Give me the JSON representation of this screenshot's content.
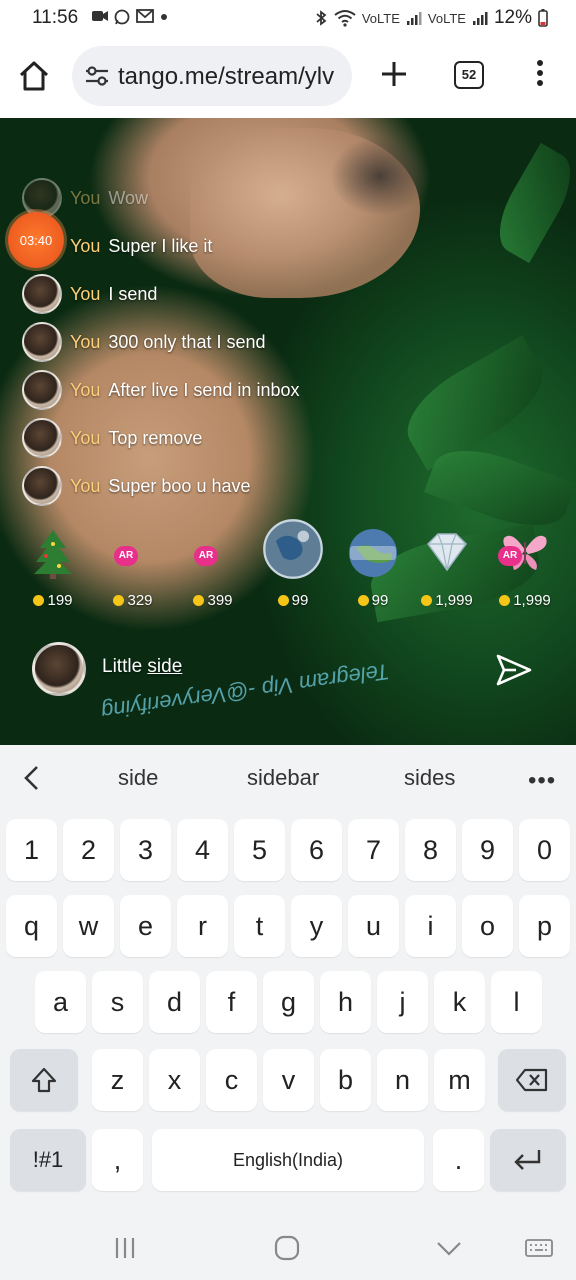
{
  "status_bar": {
    "time": "11:56",
    "notification_icons": [
      "video-icon",
      "whatsapp-icon",
      "gmail-icon",
      "dot-icon"
    ],
    "signal_text_1": "VoLTE",
    "signal_text_2": "VoLTE",
    "battery": "12%"
  },
  "browser": {
    "url": "tango.me/stream/ylv",
    "tab_count": "52"
  },
  "chat": {
    "timer": "03:40",
    "messages": [
      {
        "name": "You",
        "text": "Wow"
      },
      {
        "name": "You",
        "text": "Super I like it"
      },
      {
        "name": "You",
        "text": "I send"
      },
      {
        "name": "You",
        "text": "300 only that I send"
      },
      {
        "name": "You",
        "text": "After live I send in inbox"
      },
      {
        "name": "You",
        "text": "Top remove"
      },
      {
        "name": "You",
        "text": "Super boo u have"
      }
    ]
  },
  "gifts": [
    {
      "icon": "christmas-tree-icon",
      "price": "199",
      "badge": ""
    },
    {
      "icon": "ar-gift-icon",
      "price": "329",
      "badge": "AR"
    },
    {
      "icon": "ar-gift-icon",
      "price": "399",
      "badge": "AR"
    },
    {
      "icon": "globe-icon",
      "price": "99",
      "badge": ""
    },
    {
      "icon": "peace-globe-icon",
      "price": "99",
      "badge": ""
    },
    {
      "icon": "diamond-icon",
      "price": "1,999",
      "badge": ""
    },
    {
      "icon": "butterfly-icon",
      "price": "1,999",
      "badge": "AR"
    }
  ],
  "input": {
    "text_plain": "Little ",
    "text_underlined": "side",
    "watermark": "Telegram Vip -@Veryverifying"
  },
  "keyboard": {
    "suggestions": [
      "side",
      "sidebar",
      "sides"
    ],
    "number_row": [
      "1",
      "2",
      "3",
      "4",
      "5",
      "6",
      "7",
      "8",
      "9",
      "0"
    ],
    "row1": [
      "q",
      "w",
      "e",
      "r",
      "t",
      "y",
      "u",
      "i",
      "o",
      "p"
    ],
    "row2": [
      "a",
      "s",
      "d",
      "f",
      "g",
      "h",
      "j",
      "k",
      "l"
    ],
    "row3": [
      "z",
      "x",
      "c",
      "v",
      "b",
      "n",
      "m"
    ],
    "symbols_key": "!#1",
    "comma_key": ",",
    "space_key": "English(India)",
    "period_key": "."
  },
  "colors": {
    "accent_orange": "#e6501a",
    "name_gold": "#ffcf7a",
    "ar_pink": "#e8308a",
    "coin": "#f5c518"
  }
}
